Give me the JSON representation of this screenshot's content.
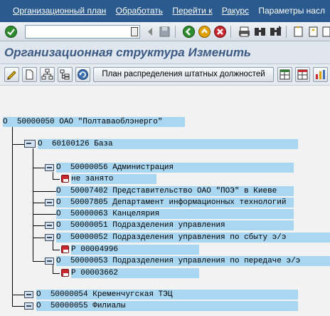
{
  "menu": {
    "items": [
      {
        "label": "Организационный план"
      },
      {
        "label": "Обработать"
      },
      {
        "label": "Перейти к"
      },
      {
        "label": "Ракурс"
      },
      {
        "label": "Параметры насл"
      }
    ]
  },
  "system_toolbar": {
    "command_value": "",
    "icons": [
      "enter-icon",
      "save-icon",
      "back-icon",
      "exit-icon",
      "cancel-icon",
      "print-icon",
      "find-icon",
      "find-next-icon",
      "first-page-icon",
      "prev-page-icon",
      "next-page-icon"
    ]
  },
  "title": "Организационная структура Изменить",
  "app_toolbar": {
    "plan_button_label": "План распределения штатных должностей"
  },
  "tree": {
    "root": {
      "type": "О",
      "id": "50000050",
      "name": "ОАО \"Полтаваоблэнерго\""
    },
    "level1": {
      "type": "О",
      "id": "60100126",
      "name": "База"
    },
    "administration": {
      "type": "О",
      "id": "50000056",
      "name": "Администрация"
    },
    "vacant_label": "не занято",
    "rep_office": {
      "type": "О",
      "id": "50007402",
      "name": "Представительство ОАО \"ПОЭ\" в Киеве"
    },
    "it_dept": {
      "type": "О",
      "id": "50007805",
      "name": "Департамент информационных технологий"
    },
    "chancellery": {
      "type": "О",
      "id": "50000063",
      "name": "Канцелярия"
    },
    "mgmt_units": {
      "type": "О",
      "id": "50000051",
      "name": "Подразделения управления"
    },
    "sales_units": {
      "type": "О",
      "id": "50000052",
      "name": "Подразделения управления по сбыту э/э"
    },
    "sales_position": {
      "type": "Р",
      "id": "00004996"
    },
    "transmission_units": {
      "type": "О",
      "id": "50000053",
      "name": "Подразделения управления по передаче э/э"
    },
    "transmission_position": {
      "type": "Р",
      "id": "00003662"
    },
    "kremenchug": {
      "type": "О",
      "id": "50000054",
      "name": "Кременчугская ТЭЦ"
    },
    "branches": {
      "type": "О",
      "id": "50000055",
      "name": "Филиалы"
    }
  }
}
